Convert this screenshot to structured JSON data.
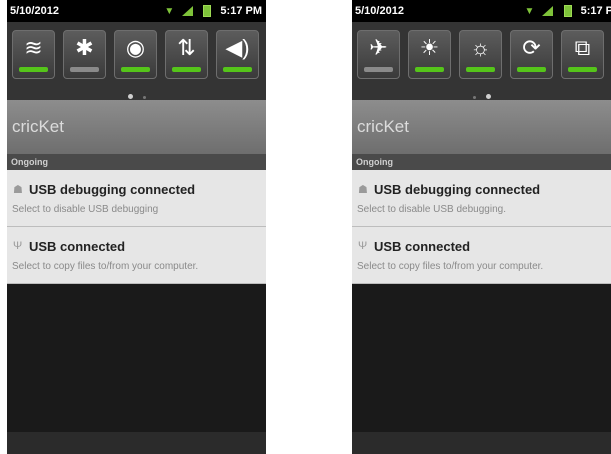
{
  "left": {
    "status": {
      "date": "5/10/2012",
      "time": "5:17 PM"
    },
    "quick_settings": [
      {
        "icon": "wifi-icon",
        "glyph": "ᯤ",
        "state": "on"
      },
      {
        "icon": "bluetooth-icon",
        "glyph": "✱",
        "state": "off"
      },
      {
        "icon": "gps-icon",
        "glyph": "◉",
        "state": "on"
      },
      {
        "icon": "data-sync-icon",
        "glyph": "⇅",
        "state": "on"
      },
      {
        "icon": "sound-icon",
        "glyph": "🔊",
        "state": "on"
      }
    ],
    "carrier": "cricKet",
    "section": "Ongoing",
    "notifications": [
      {
        "title": "USB debugging connected",
        "subtitle": "Select to disable USB debugging"
      },
      {
        "title": "USB connected",
        "subtitle": "Select to copy files to/from your computer."
      }
    ]
  },
  "right": {
    "status": {
      "date": "5/10/2012",
      "time": "5:17 P"
    },
    "quick_settings": [
      {
        "icon": "airplane-icon",
        "glyph": "✈",
        "state": "off"
      },
      {
        "icon": "brightness-icon",
        "glyph": "☀",
        "state": "on"
      },
      {
        "icon": "brightness-auto-icon",
        "glyph": "☼",
        "state": "on"
      },
      {
        "icon": "auto-sync-icon",
        "glyph": "⟳",
        "state": "on"
      },
      {
        "icon": "auto-rotate-icon",
        "glyph": "⧉",
        "state": "on"
      }
    ],
    "carrier": "cricKet",
    "section": "Ongoing",
    "notifications": [
      {
        "title": "USB debugging connected",
        "subtitle": "Select to disable USB debugging."
      },
      {
        "title": "USB connected",
        "subtitle": "Select to copy files to/from your computer."
      }
    ]
  }
}
